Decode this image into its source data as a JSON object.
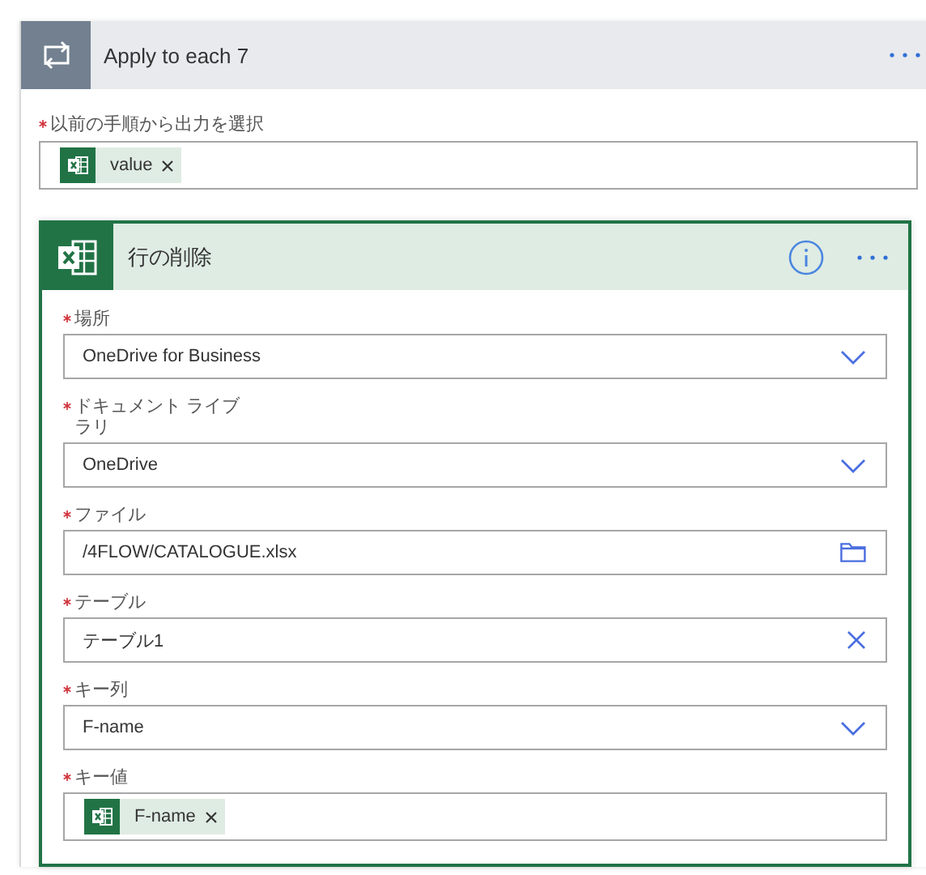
{
  "loop": {
    "title": "Apply to each 7",
    "input": {
      "label": "以前の手順から出力を選択",
      "required": true,
      "tokens": [
        "value"
      ]
    }
  },
  "action": {
    "title": "行の削除",
    "fields": [
      {
        "kind": "dropdown",
        "label": "場所",
        "required": true,
        "value": "OneDrive for Business"
      },
      {
        "kind": "dropdown",
        "label": "ドキュメント ライブラリ",
        "required": true,
        "value": "OneDrive"
      },
      {
        "kind": "file",
        "label": "ファイル",
        "required": true,
        "value": "/4FLOW/CATALOGUE.xlsx"
      },
      {
        "kind": "clearable",
        "label": "テーブル",
        "required": true,
        "value": "テーブル1"
      },
      {
        "kind": "dropdown",
        "label": "キー列",
        "required": true,
        "value": "F-name"
      },
      {
        "kind": "token",
        "label": "キー値",
        "required": true,
        "tokens": [
          "F-name"
        ]
      }
    ]
  }
}
